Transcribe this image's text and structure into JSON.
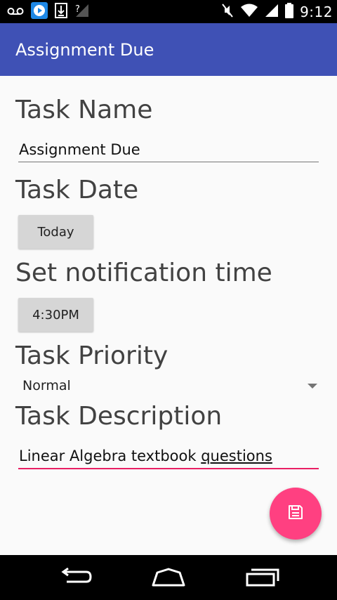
{
  "status_bar": {
    "time": "9:12",
    "icons_left": [
      "voicemail-icon",
      "media-play-icon",
      "download-icon",
      "no-signal-icon"
    ],
    "icons_right": [
      "mute-icon",
      "wifi-icon",
      "signal-icon",
      "battery-icon"
    ]
  },
  "app_bar": {
    "title": "Assignment Due",
    "color": "#3f51b5"
  },
  "form": {
    "task_name_label": "Task Name",
    "task_name_value": "Assignment Due",
    "task_date_label": "Task Date",
    "task_date_button": "Today",
    "notification_label": "Set notification time",
    "notification_button": "4:30PM",
    "priority_label": "Task Priority",
    "priority_value": "Normal",
    "description_label": "Task Description",
    "description_value_part1": "Linear Algebra textbook ",
    "description_value_part2": "questions"
  },
  "fab": {
    "icon": "save-icon",
    "color": "#ff4081"
  },
  "nav_bar": {
    "buttons": [
      "back-icon",
      "home-icon",
      "recents-icon"
    ]
  }
}
